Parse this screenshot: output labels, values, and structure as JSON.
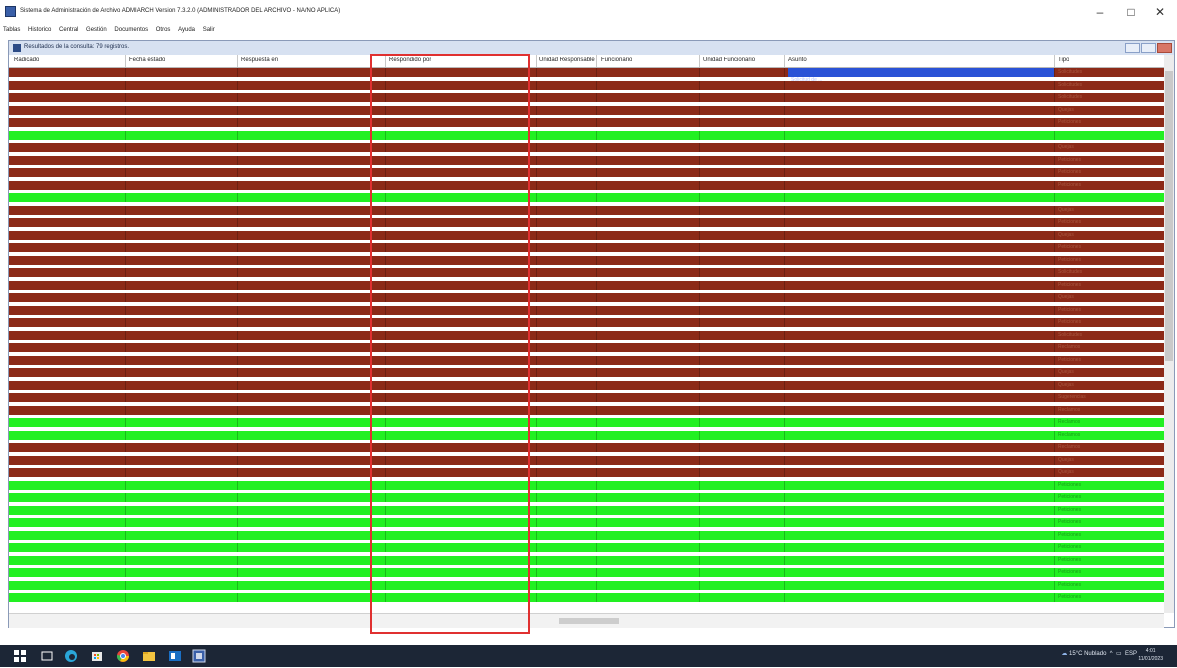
{
  "window": {
    "title": "Sistema de Administración de Archivo ADMIARCH Version 7.3.2.0 (ADMINISTRADOR DEL ARCHIVO - NA/NO APLICA)",
    "minimize": "–",
    "maximize": "□",
    "close": "✕"
  },
  "menu": [
    "Tablas",
    "Historico",
    "Central",
    "Gestión",
    "Documentos",
    "Otros",
    "Ayuda",
    "Salir"
  ],
  "results_window": {
    "title": "Resultados de la consulta: 79 registros."
  },
  "columns": [
    "Radicado",
    "Fecha estado",
    "Respuesta en",
    "Respondido por",
    "Unidad Responsable",
    "Funcionario",
    "Unidad Funcionario",
    "Asunto",
    "Tipo"
  ],
  "rows": [
    {
      "status": "red",
      "cells": [
        "",
        "",
        "",
        "",
        "",
        "",
        "",
        "Solicitud de ...",
        "Solicitudes"
      ],
      "selected": true
    },
    {
      "status": "red",
      "cells": [
        "",
        "",
        "",
        "",
        "",
        "",
        "",
        "",
        "Solicitudes"
      ]
    },
    {
      "status": "red",
      "cells": [
        "",
        "",
        "",
        "",
        "",
        "",
        "",
        "",
        "Solicitudes"
      ]
    },
    {
      "status": "red",
      "cells": [
        "",
        "",
        "",
        "",
        "",
        "",
        "",
        "",
        "Quejas"
      ]
    },
    {
      "status": "red",
      "cells": [
        "",
        "",
        "",
        "",
        "",
        "",
        "",
        "",
        "Peticiones"
      ]
    },
    {
      "status": "green",
      "cells": [
        "",
        "",
        "",
        "",
        "",
        "",
        "",
        "",
        ""
      ]
    },
    {
      "status": "red",
      "cells": [
        "",
        "",
        "",
        "",
        "",
        "",
        "",
        "",
        "Quejas"
      ]
    },
    {
      "status": "red",
      "cells": [
        "",
        "",
        "",
        "",
        "",
        "",
        "",
        "",
        "Peticiones"
      ]
    },
    {
      "status": "red",
      "cells": [
        "",
        "",
        "",
        "",
        "",
        "",
        "",
        "",
        "Peticiones"
      ]
    },
    {
      "status": "red",
      "cells": [
        "",
        "",
        "",
        "",
        "",
        "",
        "",
        "",
        "Peticiones"
      ]
    },
    {
      "status": "green",
      "cells": [
        "",
        "",
        "",
        "",
        "",
        "",
        "",
        "",
        ""
      ]
    },
    {
      "status": "red",
      "cells": [
        "",
        "",
        "",
        "",
        "",
        "",
        "",
        "",
        "Quejas"
      ]
    },
    {
      "status": "red",
      "cells": [
        "",
        "",
        "",
        "",
        "",
        "",
        "",
        "",
        "Peticiones"
      ]
    },
    {
      "status": "red",
      "cells": [
        "",
        "",
        "",
        "",
        "",
        "",
        "",
        "",
        "Quejas"
      ]
    },
    {
      "status": "red",
      "cells": [
        "",
        "",
        "",
        "",
        "",
        "",
        "",
        "",
        "Peticiones"
      ]
    },
    {
      "status": "red",
      "cells": [
        "",
        "",
        "",
        "",
        "",
        "",
        "",
        "",
        "Peticiones"
      ]
    },
    {
      "status": "red",
      "cells": [
        "",
        "",
        "",
        "",
        "",
        "",
        "",
        "",
        "Solicitudes"
      ]
    },
    {
      "status": "red",
      "cells": [
        "",
        "",
        "",
        "",
        "",
        "",
        "",
        "",
        "Peticiones"
      ]
    },
    {
      "status": "red",
      "cells": [
        "",
        "",
        "",
        "",
        "",
        "",
        "",
        "",
        "Quejas"
      ]
    },
    {
      "status": "red",
      "cells": [
        "",
        "",
        "",
        "",
        "",
        "",
        "",
        "",
        "Peticiones"
      ]
    },
    {
      "status": "red",
      "cells": [
        "",
        "",
        "",
        "",
        "",
        "",
        "",
        "",
        "Peticiones"
      ]
    },
    {
      "status": "red",
      "cells": [
        "",
        "",
        "",
        "",
        "",
        "",
        "",
        "",
        "Solicitudes"
      ]
    },
    {
      "status": "red",
      "cells": [
        "",
        "",
        "",
        "",
        "",
        "",
        "",
        "",
        "Reclamos"
      ]
    },
    {
      "status": "red",
      "cells": [
        "",
        "",
        "",
        "",
        "",
        "",
        "",
        "",
        "Peticiones"
      ]
    },
    {
      "status": "red",
      "cells": [
        "",
        "",
        "",
        "",
        "",
        "",
        "",
        "",
        "Quejas"
      ]
    },
    {
      "status": "red",
      "cells": [
        "",
        "",
        "",
        "",
        "",
        "",
        "",
        "",
        "Quejas"
      ]
    },
    {
      "status": "red",
      "cells": [
        "",
        "",
        "",
        "",
        "",
        "",
        "",
        "",
        "Sugerencias"
      ]
    },
    {
      "status": "red",
      "cells": [
        "",
        "",
        "",
        "",
        "",
        "",
        "",
        "",
        "Reclamos"
      ]
    },
    {
      "status": "green",
      "cells": [
        "",
        "",
        "",
        "",
        "",
        "",
        "",
        "",
        "Reclamos"
      ]
    },
    {
      "status": "green",
      "cells": [
        "",
        "",
        "",
        "",
        "",
        "",
        "",
        "",
        "Reclamos"
      ]
    },
    {
      "status": "red",
      "cells": [
        "",
        "",
        "",
        "",
        "",
        "",
        "",
        "",
        "Reclamos"
      ]
    },
    {
      "status": "red",
      "cells": [
        "",
        "",
        "",
        "",
        "",
        "",
        "",
        "",
        "Quejas"
      ]
    },
    {
      "status": "red",
      "cells": [
        "",
        "",
        "",
        "",
        "",
        "",
        "",
        "",
        "Quejas"
      ]
    },
    {
      "status": "green",
      "cells": [
        "",
        "",
        "",
        "",
        "",
        "",
        "",
        "",
        "Peticiones"
      ]
    },
    {
      "status": "green",
      "cells": [
        "",
        "",
        "",
        "",
        "",
        "",
        "",
        "",
        "Peticiones"
      ]
    },
    {
      "status": "green",
      "cells": [
        "",
        "",
        "",
        "",
        "",
        "",
        "",
        "",
        "Peticiones"
      ]
    },
    {
      "status": "green",
      "cells": [
        "",
        "",
        "",
        "",
        "",
        "",
        "",
        "",
        "Peticiones"
      ]
    },
    {
      "status": "green",
      "cells": [
        "",
        "",
        "",
        "",
        "",
        "",
        "",
        "",
        "Peticiones"
      ]
    },
    {
      "status": "green",
      "cells": [
        "",
        "",
        "",
        "",
        "",
        "",
        "",
        "",
        "Peticiones"
      ]
    },
    {
      "status": "green",
      "cells": [
        "",
        "",
        "",
        "",
        "",
        "",
        "",
        "",
        "Peticiones"
      ]
    },
    {
      "status": "green",
      "cells": [
        "",
        "",
        "",
        "",
        "",
        "",
        "",
        "",
        "Peticiones"
      ]
    },
    {
      "status": "green",
      "cells": [
        "",
        "",
        "",
        "",
        "",
        "",
        "",
        "",
        "Peticiones"
      ]
    },
    {
      "status": "green",
      "cells": [
        "",
        "",
        "",
        "",
        "",
        "",
        "",
        "",
        "Peticiones"
      ]
    }
  ],
  "taskbar": {
    "weather": "15°C  Nublado",
    "lang": "ESP",
    "time": "4:01",
    "date": "11/01/2023"
  },
  "colors": {
    "overdue_row": "#8c2a18",
    "answered_row": "#22f022",
    "annotation": "#e03030"
  }
}
